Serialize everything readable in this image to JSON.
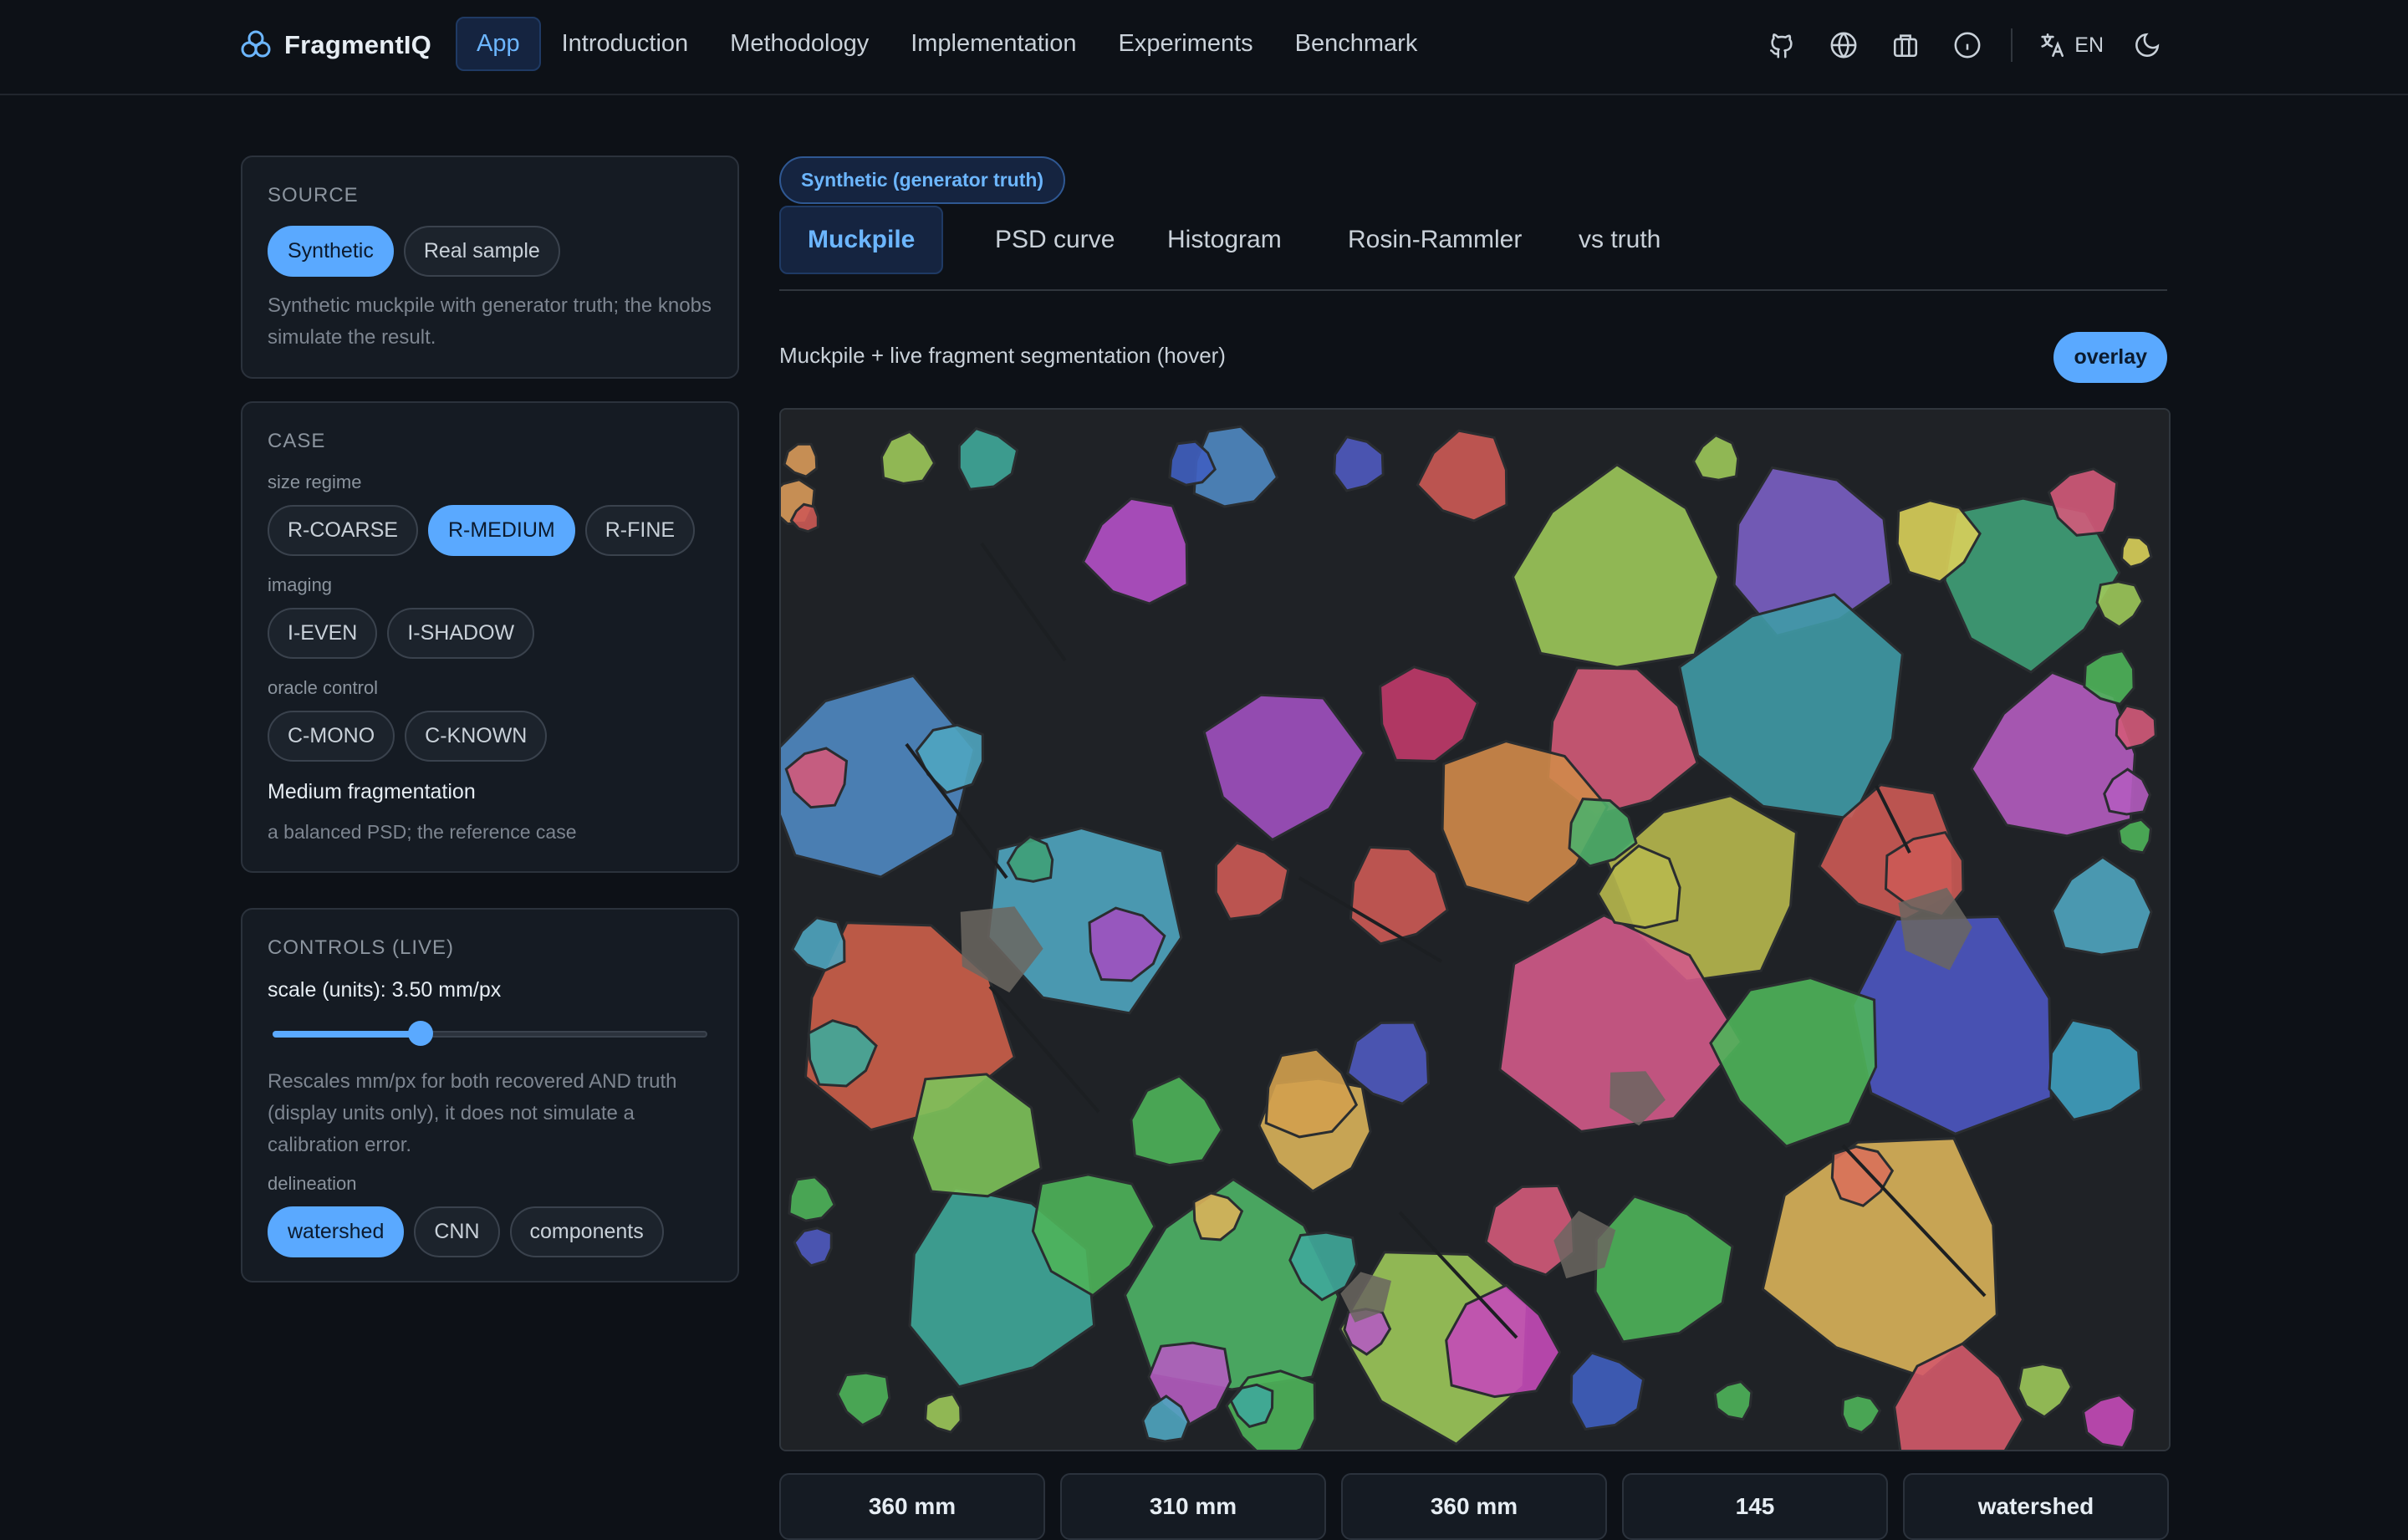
{
  "header": {
    "brand": "FragmentIQ",
    "nav": [
      {
        "label": "App",
        "active": true
      },
      {
        "label": "Introduction"
      },
      {
        "label": "Methodology"
      },
      {
        "label": "Implementation"
      },
      {
        "label": "Experiments"
      },
      {
        "label": "Benchmark"
      }
    ],
    "icons": [
      "github-icon",
      "globe-icon",
      "briefcase-icon",
      "info-icon"
    ],
    "language": "EN"
  },
  "source": {
    "title": "SOURCE",
    "options": [
      "Synthetic",
      "Real sample"
    ],
    "selected": "Synthetic",
    "description": "Synthetic muckpile with generator truth; the knobs simulate the result."
  },
  "case": {
    "title": "CASE",
    "size_label": "size regime",
    "size_options": [
      "R-COARSE",
      "R-MEDIUM",
      "R-FINE"
    ],
    "size_selected": "R-MEDIUM",
    "imaging_label": "imaging",
    "imaging_options": [
      "I-EVEN",
      "I-SHADOW"
    ],
    "oracle_label": "oracle control",
    "oracle_options": [
      "C-MONO",
      "C-KNOWN"
    ],
    "case_name": "Medium fragmentation",
    "case_desc": "a balanced PSD; the reference case"
  },
  "controls": {
    "title": "CONTROLS (LIVE)",
    "scale_label": "scale (units): 3.50 mm/px",
    "scale_fraction": 0.34,
    "scale_desc": "Rescales mm/px for both recovered AND truth (display units only), it does not simulate a calibration error.",
    "delineation_label": "delineation",
    "delineation_options": [
      "watershed",
      "CNN",
      "components"
    ],
    "delineation_selected": "watershed"
  },
  "main": {
    "badge": "Synthetic (generator truth)",
    "tabs": [
      "Muckpile",
      "PSD curve",
      "Histogram",
      "Rosin-Rammler",
      "vs truth"
    ],
    "active_tab": "Muckpile",
    "caption": "Muckpile + live fragment segmentation (hover)",
    "overlay_label": "overlay",
    "stats": [
      "360 mm",
      "310 mm",
      "360 mm",
      "145",
      "watershed"
    ]
  },
  "colors": {
    "accent": "#5aa9ff",
    "background": "#0d1117",
    "card": "#151b23"
  }
}
